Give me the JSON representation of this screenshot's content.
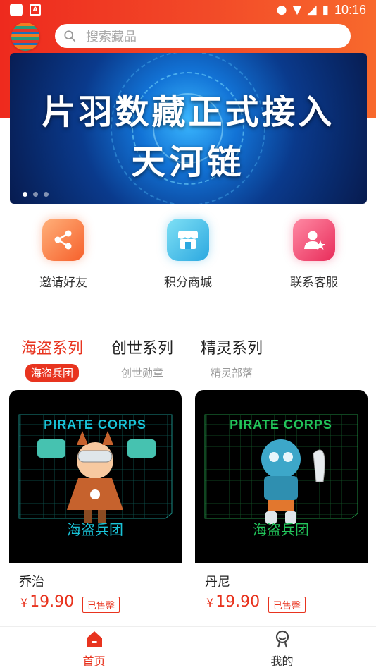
{
  "status_bar": {
    "time": "10:16"
  },
  "search": {
    "placeholder": "搜索藏品"
  },
  "banner": {
    "line1": "片羽数藏正式接入",
    "line2": "天河链",
    "slide_count": 3,
    "active_slide": 1
  },
  "actions": [
    {
      "label": "邀请好友",
      "icon": "share-icon",
      "color": "#f97a3b"
    },
    {
      "label": "积分商城",
      "icon": "shop-icon",
      "color": "#3bb6e8"
    },
    {
      "label": "联系客服",
      "icon": "customer-service-icon",
      "color": "#f0416a"
    }
  ],
  "series": [
    {
      "title": "海盗系列",
      "sub": "海盗兵团",
      "active": true
    },
    {
      "title": "创世系列",
      "sub": "创世勋章",
      "active": false
    },
    {
      "title": "精灵系列",
      "sub": "精灵部落",
      "active": false
    }
  ],
  "products": [
    {
      "title": "乔治",
      "price": "19.90",
      "currency": "¥",
      "badge": "已售罄",
      "art_title": "PIRATE CORPS",
      "art_caption": "海盗兵团",
      "art_color": "#19c3d8"
    },
    {
      "title": "丹尼",
      "price": "19.90",
      "currency": "¥",
      "badge": "已售罄",
      "art_title": "PIRATE CORPS",
      "art_caption": "海盗兵团",
      "art_color": "#22c45a"
    }
  ],
  "bottom_nav": [
    {
      "label": "首页",
      "icon": "home-icon",
      "active": true
    },
    {
      "label": "我的",
      "icon": "profile-icon",
      "active": false
    }
  ],
  "colors": {
    "accent": "#e8341f",
    "header_start": "#ee2a1e",
    "header_end": "#f8692c"
  }
}
